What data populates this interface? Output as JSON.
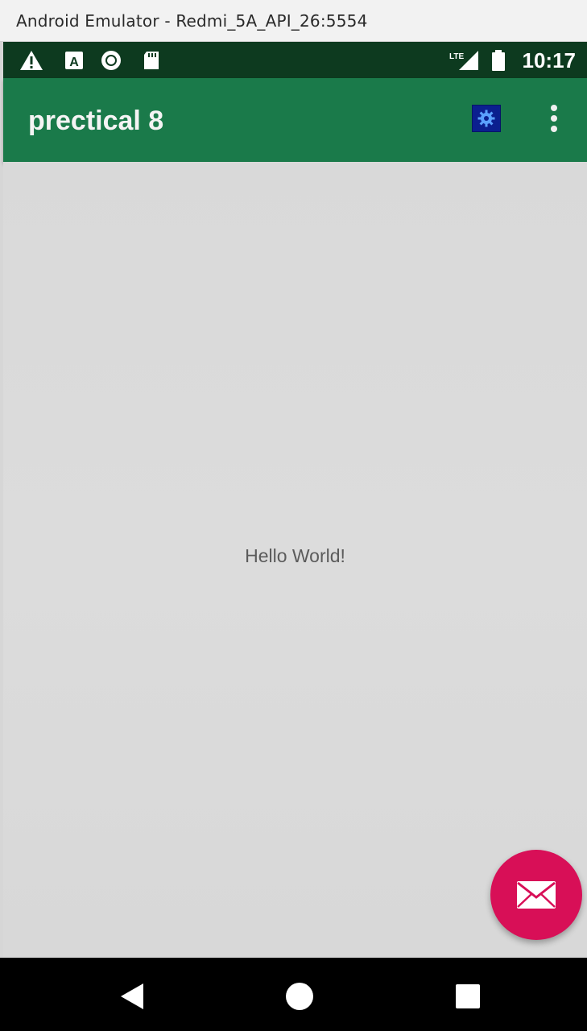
{
  "emulator": {
    "title": "Android Emulator - Redmi_5A_API_26:5554"
  },
  "status_bar": {
    "time": "10:17",
    "network": "LTE",
    "icons": [
      "warning-icon",
      "a-notification-icon",
      "circle-notification-icon",
      "sd-card-icon",
      "lte-signal-icon",
      "battery-icon"
    ]
  },
  "app_bar": {
    "title": "prectical 8",
    "actions": [
      "settings-icon",
      "overflow-menu-icon"
    ]
  },
  "content": {
    "message": "Hello World!"
  },
  "fab": {
    "icon": "mail-icon"
  },
  "nav_bar": {
    "buttons": [
      "back-icon",
      "home-icon",
      "recents-icon"
    ]
  },
  "colors": {
    "status_bar": "#0d3a1f",
    "app_bar": "#1a7a4a",
    "fab": "#d80f57",
    "settings_button": "#0b1f8f"
  }
}
